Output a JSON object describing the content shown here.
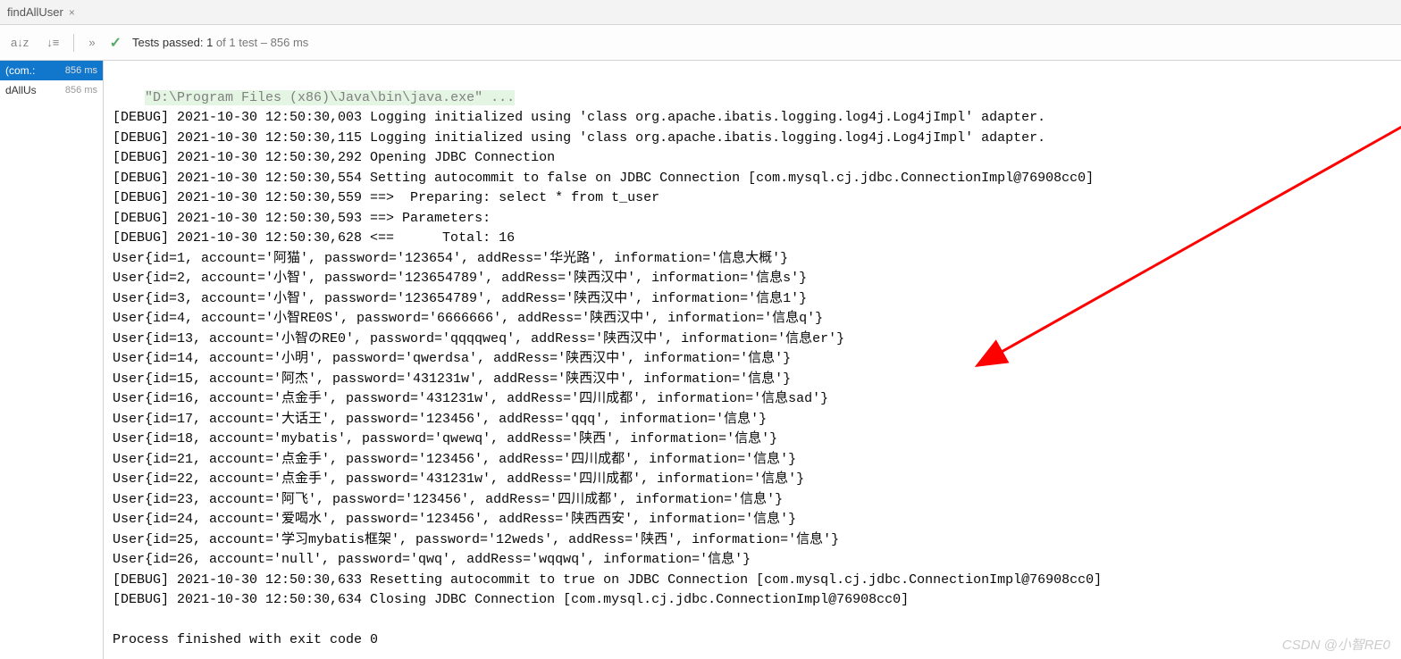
{
  "tab": {
    "title": "findAllUser",
    "close": "×"
  },
  "toolbar": {
    "icon1": "a↓z",
    "icon2": "↓≡",
    "chevron": "»",
    "check": "✓",
    "status_prefix": "Tests passed: ",
    "status_count": "1",
    "status_of": " of 1 test",
    "status_time": " – 856 ms"
  },
  "sidebar": {
    "items": [
      {
        "label": "(com.:",
        "time": "856 ms",
        "selected": true
      },
      {
        "label": "dAllUs",
        "time": "856 ms",
        "selected": false
      }
    ]
  },
  "console": {
    "command": "\"D:\\Program Files (x86)\\Java\\bin\\java.exe\" ...",
    "lines": [
      "[DEBUG] 2021-10-30 12:50:30,003 Logging initialized using 'class org.apache.ibatis.logging.log4j.Log4jImpl' adapter.",
      "[DEBUG] 2021-10-30 12:50:30,115 Logging initialized using 'class org.apache.ibatis.logging.log4j.Log4jImpl' adapter.",
      "[DEBUG] 2021-10-30 12:50:30,292 Opening JDBC Connection",
      "[DEBUG] 2021-10-30 12:50:30,554 Setting autocommit to false on JDBC Connection [com.mysql.cj.jdbc.ConnectionImpl@76908cc0]",
      "[DEBUG] 2021-10-30 12:50:30,559 ==>  Preparing: select * from t_user",
      "[DEBUG] 2021-10-30 12:50:30,593 ==> Parameters:",
      "[DEBUG] 2021-10-30 12:50:30,628 <==      Total: 16",
      "User{id=1, account='阿猫', password='123654', addRess='华光路', information='信息大概'}",
      "User{id=2, account='小智', password='123654789', addRess='陕西汉中', information='信息s'}",
      "User{id=3, account='小智', password='123654789', addRess='陕西汉中', information='信息1'}",
      "User{id=4, account='小智RE0S', password='6666666', addRess='陕西汉中', information='信息q'}",
      "User{id=13, account='小智のRE0', password='qqqqweq', addRess='陕西汉中', information='信息er'}",
      "User{id=14, account='小明', password='qwerdsa', addRess='陕西汉中', information='信息'}",
      "User{id=15, account='阿杰', password='431231w', addRess='陕西汉中', information='信息'}",
      "User{id=16, account='点金手', password='431231w', addRess='四川成都', information='信息sad'}",
      "User{id=17, account='大话王', password='123456', addRess='qqq', information='信息'}",
      "User{id=18, account='mybatis', password='qwewq', addRess='陕西', information='信息'}",
      "User{id=21, account='点金手', password='123456', addRess='四川成都', information='信息'}",
      "User{id=22, account='点金手', password='431231w', addRess='四川成都', information='信息'}",
      "User{id=23, account='阿飞', password='123456', addRess='四川成都', information='信息'}",
      "User{id=24, account='爱喝水', password='123456', addRess='陕西西安', information='信息'}",
      "User{id=25, account='学习mybatis框架', password='12weds', addRess='陕西', information='信息'}",
      "User{id=26, account='null', password='qwq', addRess='wqqwq', information='信息'}",
      "[DEBUG] 2021-10-30 12:50:30,633 Resetting autocommit to true on JDBC Connection [com.mysql.cj.jdbc.ConnectionImpl@76908cc0]",
      "[DEBUG] 2021-10-30 12:50:30,634 Closing JDBC Connection [com.mysql.cj.jdbc.ConnectionImpl@76908cc0]"
    ],
    "finished": "Process finished with exit code 0"
  },
  "watermark": "CSDN @小智RE0"
}
